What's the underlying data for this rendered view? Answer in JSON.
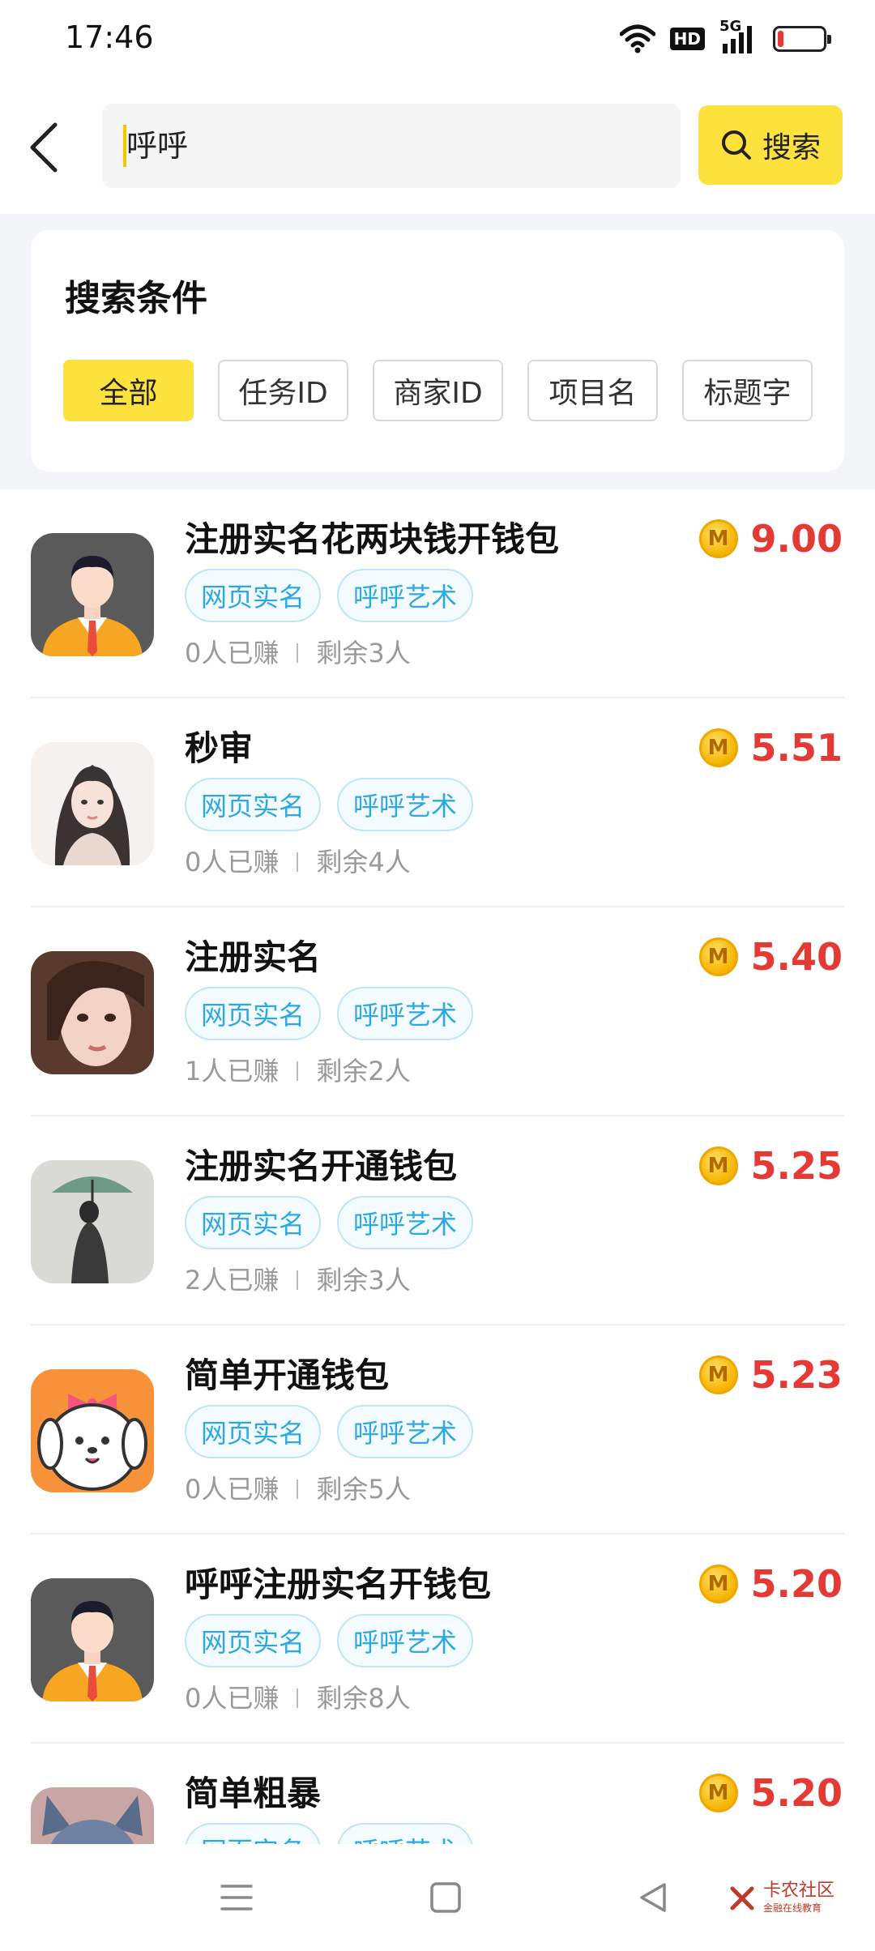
{
  "status_bar": {
    "time": "17:46",
    "hd": "HD",
    "network": "5G",
    "battery_level": 0.12
  },
  "header": {
    "search_value": "呼呼",
    "search_button_label": "搜索"
  },
  "filter": {
    "title": "搜索条件",
    "chips": [
      {
        "label": "全部",
        "active": true
      },
      {
        "label": "任务ID",
        "active": false
      },
      {
        "label": "商家ID",
        "active": false
      },
      {
        "label": "项目名",
        "active": false
      },
      {
        "label": "标题字",
        "active": false
      }
    ]
  },
  "tasks": [
    {
      "title": "注册实名花两块钱开钱包",
      "tags": [
        "网页实名",
        "呼呼艺术"
      ],
      "earned": "0人已赚",
      "remaining": "剩余3人",
      "reward": "9.00",
      "avatar": "man-avatar"
    },
    {
      "title": "秒审",
      "tags": [
        "网页实名",
        "呼呼艺术"
      ],
      "earned": "0人已赚",
      "remaining": "剩余4人",
      "reward": "5.51",
      "avatar": "anime-girl-avatar"
    },
    {
      "title": "注册实名",
      "tags": [
        "网页实名",
        "呼呼艺术"
      ],
      "earned": "1人已赚",
      "remaining": "剩余2人",
      "reward": "5.40",
      "avatar": "girl-photo-avatar"
    },
    {
      "title": "注册实名开通钱包",
      "tags": [
        "网页实名",
        "呼呼艺术"
      ],
      "earned": "2人已赚",
      "remaining": "剩余3人",
      "reward": "5.25",
      "avatar": "umbrella-avatar"
    },
    {
      "title": "简单开通钱包",
      "tags": [
        "网页实名",
        "呼呼艺术"
      ],
      "earned": "0人已赚",
      "remaining": "剩余5人",
      "reward": "5.23",
      "avatar": "puppy-avatar"
    },
    {
      "title": "呼呼注册实名开钱包",
      "tags": [
        "网页实名",
        "呼呼艺术"
      ],
      "earned": "0人已赚",
      "remaining": "剩余8人",
      "reward": "5.20",
      "avatar": "man-avatar"
    },
    {
      "title": "简单粗暴",
      "tags": [
        "网页实名",
        "呼呼艺术"
      ],
      "earned": "",
      "remaining": "",
      "reward": "5.20",
      "avatar": "cat-avatar"
    }
  ],
  "coin_letter": "M",
  "watermark": {
    "text": "卡农社区",
    "sub": "金融在线教育"
  },
  "colors": {
    "accent": "#fde13d",
    "price": "#e53935",
    "tag": "#2ea8e0"
  }
}
